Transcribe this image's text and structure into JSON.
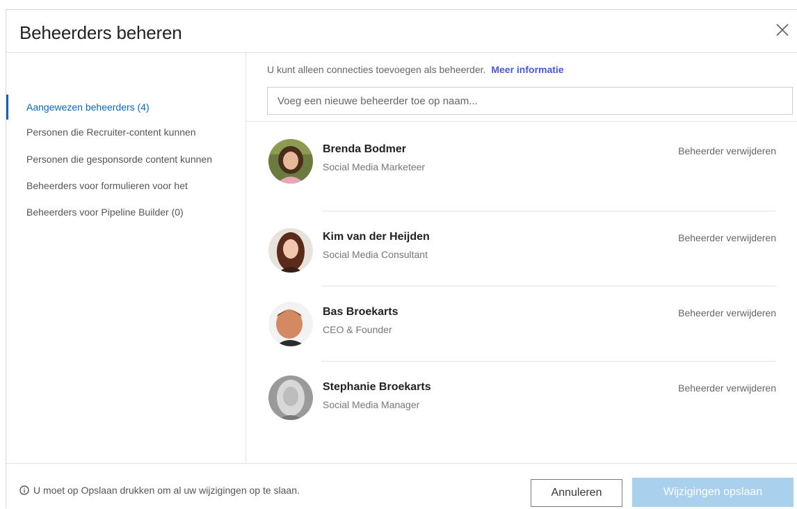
{
  "dialog": {
    "title": "Beheerders beheren"
  },
  "sidebar": {
    "items": [
      {
        "label": "Aangewezen beheerders (4)",
        "active": true
      },
      {
        "label": "Personen die Recruiter-content kunnen"
      },
      {
        "label": "Personen die gesponsorde content kunnen"
      },
      {
        "label": "Beheerders voor formulieren voor het"
      },
      {
        "label": "Beheerders voor Pipeline Builder (0)"
      }
    ]
  },
  "main": {
    "info_text": "U kunt alleen connecties toevoegen als beheerder.",
    "info_link": "Meer informatie",
    "search_placeholder": "Voeg een nieuwe beheerder toe op naam...",
    "admins": [
      {
        "name": "Brenda Bodmer",
        "role": "Social Media Marketeer",
        "action": "Beheerder verwijderen"
      },
      {
        "name": "Kim van der Heijden",
        "role": "Social Media Consultant",
        "action": "Beheerder verwijderen"
      },
      {
        "name": "Bas Broekarts",
        "role": "CEO & Founder",
        "action": "Beheerder verwijderen"
      },
      {
        "name": "Stephanie Broekarts",
        "role": "Social Media Manager",
        "action": "Beheerder verwijderen"
      }
    ]
  },
  "footer": {
    "note": "U moet op Opslaan drukken om al uw wijzigingen op te slaan.",
    "cancel_label": "Annuleren",
    "save_label": "Wijzigingen opslaan"
  },
  "colors": {
    "accent": "#0a66c2",
    "link": "#4a57d8",
    "save_disabled": "#a9d1ee"
  }
}
